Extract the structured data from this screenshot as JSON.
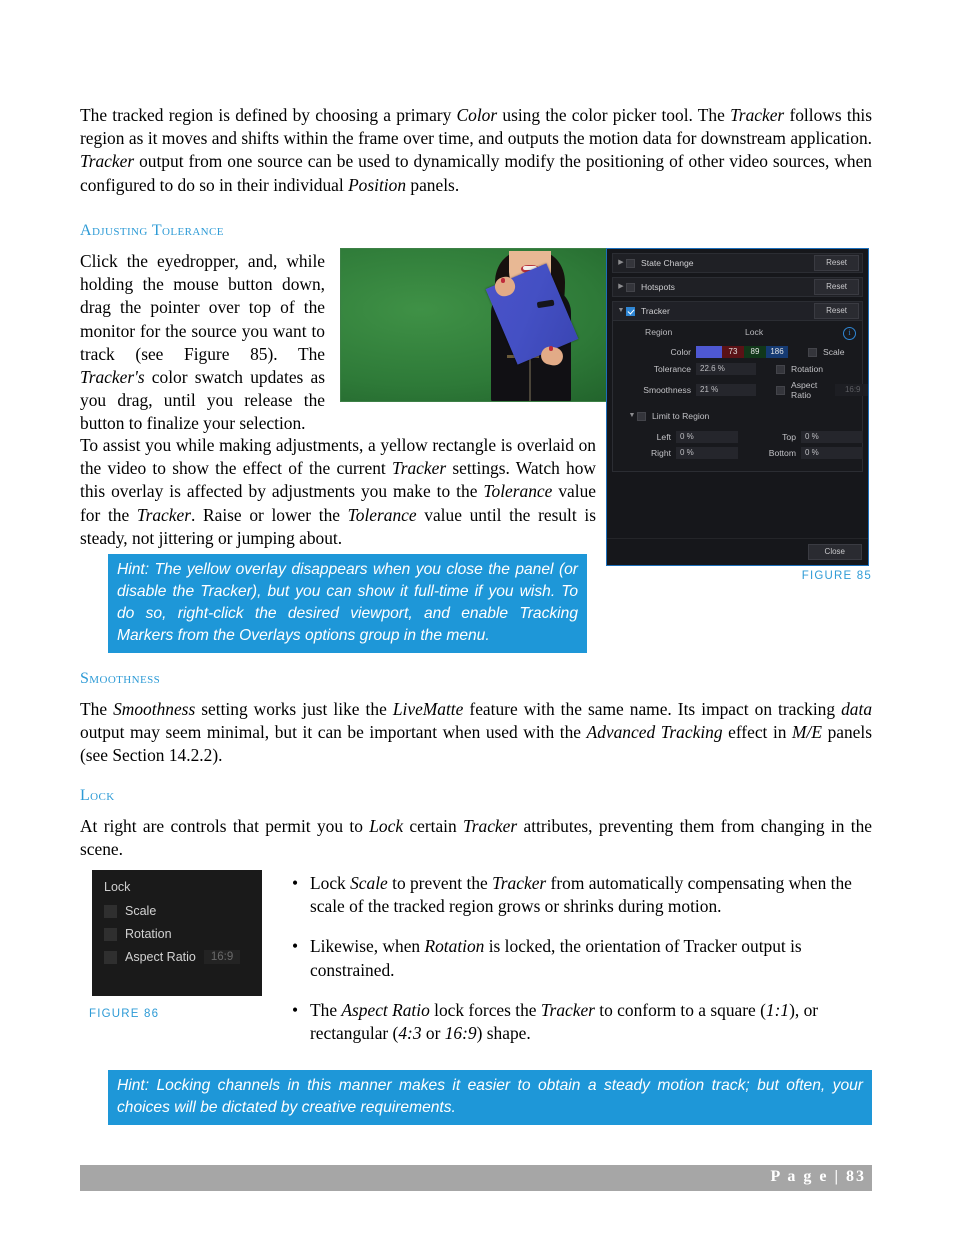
{
  "document": {
    "intro_paragraph": "The tracked region is defined by choosing a primary Color using the color picker tool. The Tracker follows this region as it moves and shifts within the frame over time, and outputs the motion data for downstream application. Tracker output from one source can be used to dynamically modify the positioning of other video sources, when configured to do so in their individual Position panels.",
    "sections": {
      "adjusting_tolerance": {
        "heading": "Adjusting Tolerance",
        "paragraph_1": "Click the eyedropper, and, while holding the mouse button down, drag the pointer over top of the monitor for the source you want to track (see Figure 85). The Tracker's color swatch updates as you drag, until you release the button to finalize your selection.",
        "paragraph_2": "To assist you while making adjustments, a yellow rectangle is overlaid on the video to show the effect of the current Tracker settings. Watch how this overlay is affected by adjustments you make to the Tolerance value for the Tracker. Raise or lower the Tolerance value until the result is steady, not jittering or jumping about.",
        "hint": "Hint: The yellow overlay disappears when you close the panel (or disable the Tracker), but you can show it full-time if you wish.  To do so, right-click the desired viewport, and enable Tracking Markers from the Overlays options group in the menu."
      },
      "smoothness": {
        "heading": "Smoothness",
        "paragraph": "The Smoothness setting works just like the LiveMatte feature with the same name.  Its impact on tracking data output may seem minimal, but it can be important when used with the Advanced Tracking effect in M/E panels (see Section 14.2.2)."
      },
      "lock": {
        "heading": "Lock",
        "paragraph": "At right are controls that permit you to Lock certain Tracker attributes, preventing them from changing in the scene.",
        "bullets": [
          "Lock Scale to prevent the Tracker from automatically compensating when the scale of the tracked region grows or shrinks during motion.",
          "Likewise, when Rotation is locked, the orientation of Tracker output is constrained.",
          "The Aspect Ratio lock forces the Tracker to conform to a square (1:1), or rectangular (4:3 or 16:9) shape."
        ],
        "hint": "Hint: Locking channels in this manner makes it easier to obtain a steady motion track; but often, your choices will be dictated by creative requirements."
      }
    },
    "footer": {
      "page_label": "P a g e  | 83"
    },
    "colors": {
      "heading_blue": "#2e9bd6",
      "hint_background": "#1e97d8",
      "footer_bar": "#a6a6a6",
      "swatch_blue": "#4e58d2"
    }
  },
  "figure85": {
    "caption": "FIGURE 85",
    "accordion": [
      {
        "label": "State Change",
        "reset": "Reset",
        "expanded": false,
        "checked": false
      },
      {
        "label": "Hotspots",
        "reset": "Reset",
        "expanded": false,
        "checked": false
      },
      {
        "label": "Tracker",
        "reset": "Reset",
        "expanded": true,
        "checked": true
      }
    ],
    "tracker": {
      "region_label": "Region",
      "lock_label": "Lock",
      "info_icon": "i",
      "color_label": "Color",
      "color_r": "73",
      "color_g": "89",
      "color_b": "186",
      "tolerance_label": "Tolerance",
      "tolerance_value": "22.6 %",
      "smoothness_label": "Smoothness",
      "smoothness_value": "21 %",
      "lock_scale_label": "Scale",
      "lock_rotation_label": "Rotation",
      "lock_aspect_label": "Aspect Ratio",
      "lock_aspect_value": "16:9",
      "limit_to_region_label": "Limit to Region",
      "left_label": "Left",
      "left_value": "0 %",
      "top_label": "Top",
      "top_value": "0 %",
      "right_label": "Right",
      "right_value": "0 %",
      "bottom_label": "Bottom",
      "bottom_value": "0 %"
    },
    "close_button": "Close"
  },
  "figure86": {
    "caption": "FIGURE 86",
    "title": "Lock",
    "rows": [
      {
        "label": "Scale",
        "value": ""
      },
      {
        "label": "Rotation",
        "value": ""
      },
      {
        "label": "Aspect Ratio",
        "value": "16:9"
      }
    ]
  }
}
